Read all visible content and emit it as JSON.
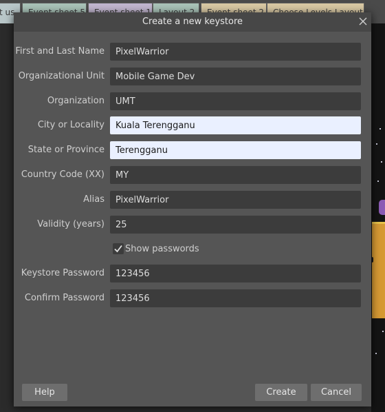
{
  "background": {
    "tabs": [
      {
        "label": "t us"
      },
      {
        "label": "Event sheet 5"
      },
      {
        "label": "Event sheet 1"
      },
      {
        "label": "Layout 2"
      },
      {
        "label": "Event sheet 2"
      },
      {
        "label": "Choose Levels Layout"
      }
    ]
  },
  "dialog": {
    "title": "Create a new keystore",
    "close_icon": "close-icon",
    "fields": {
      "first_last_name": {
        "label": "First and Last Name",
        "value": "PixelWarrior"
      },
      "organizational_unit": {
        "label": "Organizational Unit",
        "value": "Mobile Game Dev"
      },
      "organization": {
        "label": "Organization",
        "value": "UMT"
      },
      "city": {
        "label": "City or Locality",
        "value": "Kuala Terengganu"
      },
      "state": {
        "label": "State or Province",
        "value": "Terengganu"
      },
      "country": {
        "label": "Country Code (XX)",
        "value": "MY"
      },
      "alias": {
        "label": "Alias",
        "value": "PixelWarrior"
      },
      "validity": {
        "label": "Validity (years)",
        "value": "25"
      },
      "keystore_password": {
        "label": "Keystore Password",
        "value": "123456"
      },
      "confirm_password": {
        "label": "Confirm Password",
        "value": "123456"
      }
    },
    "show_passwords": {
      "label": "Show passwords",
      "checked": true
    },
    "buttons": {
      "help": "Help",
      "create": "Create",
      "cancel": "Cancel"
    }
  },
  "colors": {
    "dialog_bg": "#555555",
    "titlebar_bg": "#474747",
    "field_bg": "#3c3c3c",
    "field_highlight_bg": "#eaf0ff",
    "button_bg": "#6e6e6e"
  }
}
